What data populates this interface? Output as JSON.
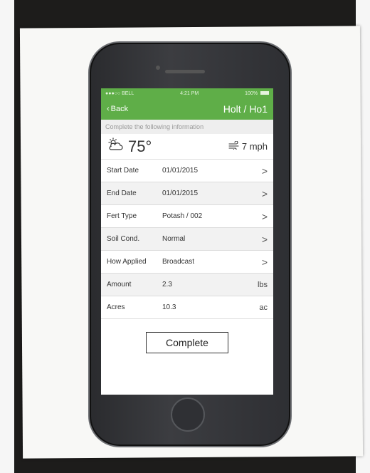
{
  "status_bar": {
    "carrier": "BELL",
    "time": "4:21 PM",
    "battery": "100%"
  },
  "nav": {
    "back_label": "Back",
    "title": "Holt / Ho1"
  },
  "instruction": "Complete the following information",
  "weather": {
    "temperature": "75°",
    "wind": "7 mph",
    "condition_icon": "partly-cloudy-icon",
    "wind_icon": "wind-icon"
  },
  "fields": [
    {
      "label": "Start Date",
      "value": "01/01/2015",
      "tail": ">"
    },
    {
      "label": "End Date",
      "value": "01/01/2015",
      "tail": ">"
    },
    {
      "label": "Fert Type",
      "value": "Potash / 002",
      "tail": ">"
    },
    {
      "label": "Soil Cond.",
      "value": "Normal",
      "tail": ">"
    },
    {
      "label": "How Applied",
      "value": "Broadcast",
      "tail": ">"
    },
    {
      "label": "Amount",
      "value": "2.3",
      "tail": "lbs"
    },
    {
      "label": "Acres",
      "value": "10.3",
      "tail": "ac"
    }
  ],
  "complete_label": "Complete",
  "colors": {
    "accent_green": "#5fae48",
    "row_shade": "#f2f2f2"
  }
}
